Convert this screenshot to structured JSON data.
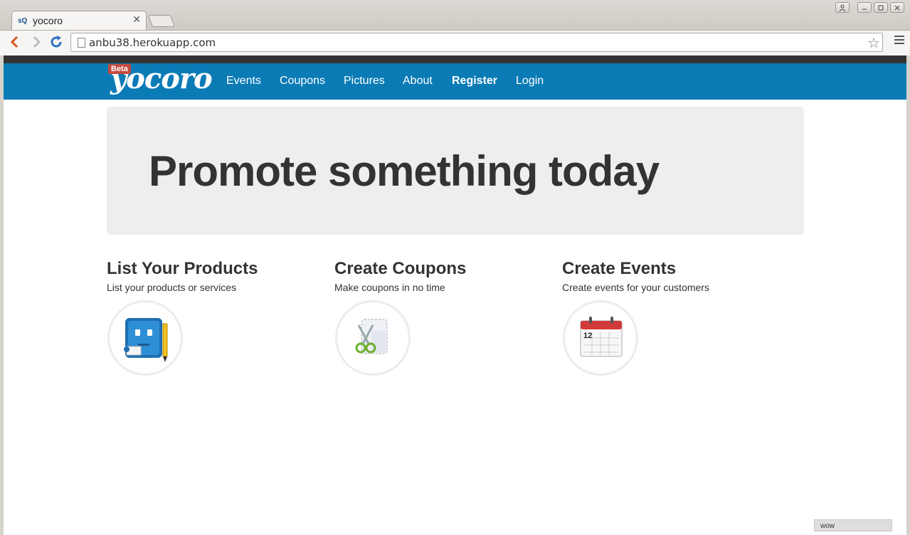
{
  "browser": {
    "tab_favicon": "sQ",
    "tab_title": "yocoro",
    "tab_close": "✕",
    "url": "anbu38.herokuapp.com"
  },
  "navbar": {
    "beta": "Beta",
    "logo": "yocoro",
    "links": [
      "Events",
      "Coupons",
      "Pictures",
      "About",
      "Register",
      "Login"
    ]
  },
  "hero": {
    "title": "Promote something today"
  },
  "features": [
    {
      "title": "List Your Products",
      "subtitle": "List your products or services",
      "icon": "app-pencil-icon"
    },
    {
      "title": "Create Coupons",
      "subtitle": "Make coupons in no time",
      "icon": "scissors-coupon-icon"
    },
    {
      "title": "Create Events",
      "subtitle": "Create events for your customers",
      "icon": "calendar-icon"
    }
  ],
  "calendar_day": "12",
  "status": "wow",
  "colors": {
    "navbar": "#0b7bb6",
    "hero_bg": "#eeeeee",
    "beta": "#c34a3e",
    "text": "#333333"
  }
}
